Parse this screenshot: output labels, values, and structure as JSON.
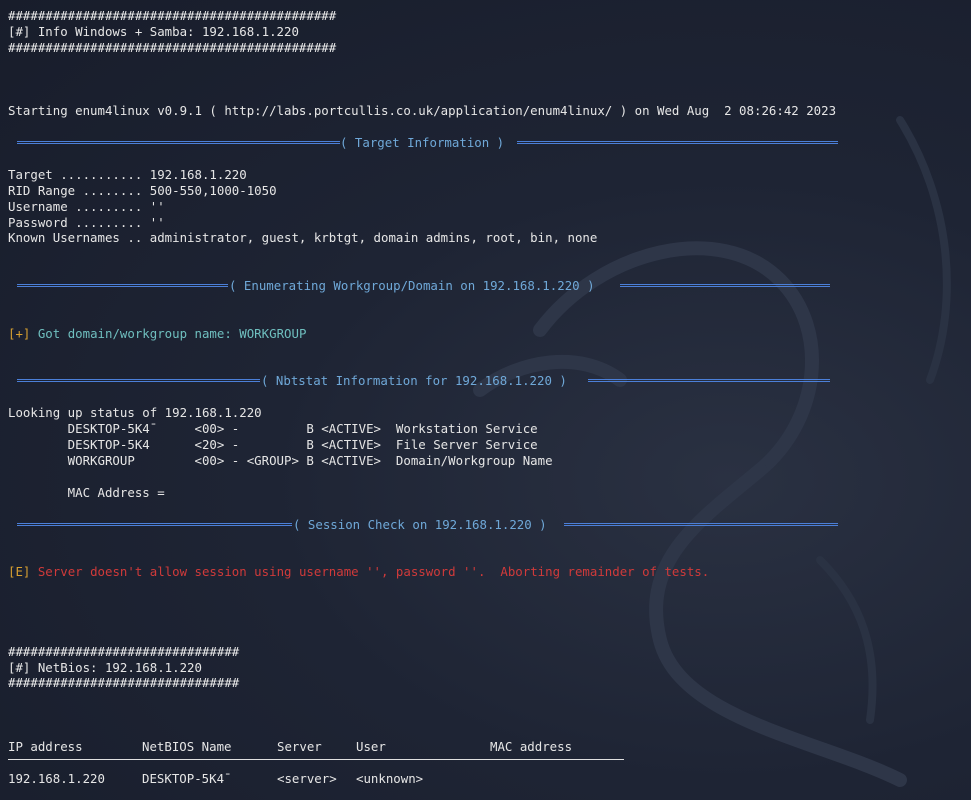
{
  "header": {
    "hash_line": "############################################",
    "title": "[#] Info Windows + Samba: 192.168.1.220"
  },
  "start_line": "Starting enum4linux v0.9.1 ( http://labs.portcullis.co.uk/application/enum4linux/ ) on Wed Aug  2 08:26:42 2023",
  "sections": {
    "target": "( Target Information )",
    "workgroup": "( Enumerating Workgroup/Domain on 192.168.1.220 )",
    "nbtstat": "( Nbtstat Information for 192.168.1.220 )",
    "session": "( Session Check on 192.168.1.220 )"
  },
  "target_info": [
    "Target ........... 192.168.1.220",
    "RID Range ........ 500-550,1000-1050",
    "Username ......... ''",
    "Password ......... ''",
    "Known Usernames .. administrator, guest, krbtgt, domain admins, root, bin, none"
  ],
  "workgroup": {
    "prefix": "[+]",
    "message": " Got domain/workgroup name: WORKGROUP"
  },
  "nbtstat": {
    "lookup": "Looking up status of 192.168.1.220",
    "entries": [
      "        DESKTOP-5K4¯     <00> -         B <ACTIVE>  Workstation Service",
      "        DESKTOP-5K4      <20> -         B <ACTIVE>  File Server Service",
      "        WORKGROUP        <00> - <GROUP> B <ACTIVE>  Domain/Workgroup Name"
    ],
    "mac": "        MAC Address ="
  },
  "session": {
    "prefix": "[E]",
    "message": " Server doesn't allow session using username '', password ''.  Aborting remainder of tests."
  },
  "netbios_header": {
    "hash_line": "###############################",
    "title": "[#] NetBios: 192.168.1.220"
  },
  "table": {
    "columns": [
      "IP address",
      "NetBIOS Name",
      "Server",
      "User",
      "MAC address"
    ],
    "rows": [
      [
        "192.168.1.220",
        "DESKTOP-5K4¯",
        "<server>",
        "<unknown>",
        ""
      ]
    ]
  },
  "colors": {
    "background": "#1c2233",
    "text": "#e6e6e6",
    "section_bar": "#4b7fd8",
    "section_title": "#6fa8d8",
    "info_prefix": "#d8a030",
    "info_text": "#6fbfbf",
    "error_text": "#d03a3a"
  }
}
